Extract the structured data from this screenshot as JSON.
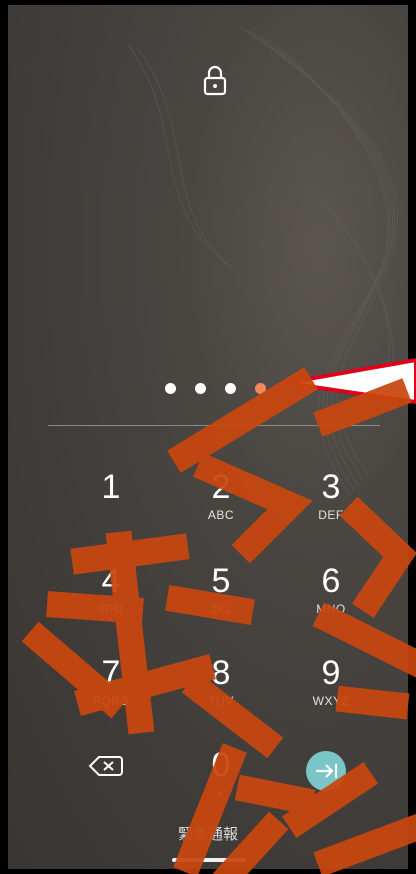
{
  "colors": {
    "background": "#433f3c",
    "dot_filled": "#ffffff",
    "dot_active": "#f08a5d",
    "enter_button": "#7ac5c8",
    "watermark": "#c9460f",
    "callout_stroke": "#e0001b"
  },
  "lock": {
    "icon": "padlock-icon"
  },
  "pin": {
    "entered_count": 4
  },
  "keypad": {
    "keys": [
      {
        "number": "1",
        "letters": ""
      },
      {
        "number": "2",
        "letters": "ABC"
      },
      {
        "number": "3",
        "letters": "DEF"
      },
      {
        "number": "4",
        "letters": "GHI"
      },
      {
        "number": "5",
        "letters": "JKL"
      },
      {
        "number": "6",
        "letters": "MNO"
      },
      {
        "number": "7",
        "letters": "PQRS"
      },
      {
        "number": "8",
        "letters": "TUV"
      },
      {
        "number": "9",
        "letters": "WXYZ"
      },
      {
        "number": "0",
        "letters": "+"
      }
    ],
    "backspace_icon": "backspace-icon",
    "enter_icon": "enter-arrow-icon"
  },
  "emergency_label": "緊急通報"
}
